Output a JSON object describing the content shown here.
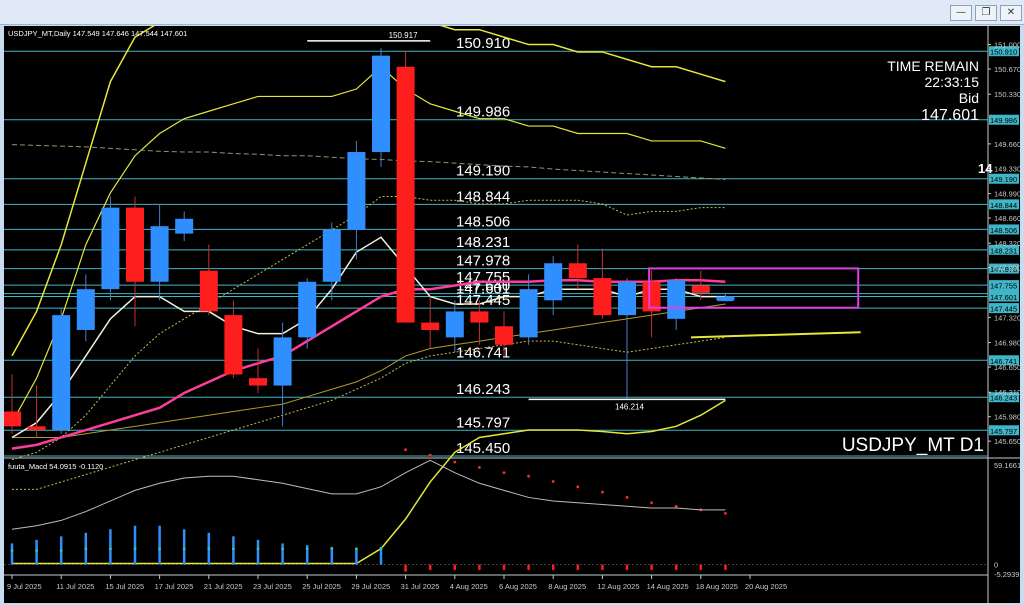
{
  "window": {
    "minimize_label": "—",
    "restore_label": "❐",
    "close_label": "✕"
  },
  "chart_data": {
    "type": "candlestick",
    "header": "USDJPY_MT,Daily  147.549 147.646 147.544 147.601",
    "symbol_watermark": "USDJPY_MT D1",
    "x_labels": [
      "9 Jul 2025",
      "11 Jul 2025",
      "15 Jul 2025",
      "17 Jul 2025",
      "21 Jul 2025",
      "23 Jul 2025",
      "25 Jul 2025",
      "29 Jul 2025",
      "31 Jul 2025",
      "4 Aug 2025",
      "6 Aug 2025",
      "8 Aug 2025",
      "12 Aug 2025",
      "14 Aug 2025",
      "18 Aug 2025",
      "20 Aug 2025"
    ],
    "y_ticks": [
      "151.000",
      "150.670",
      "150.330",
      "149.660",
      "149.330",
      "148.990",
      "148.660",
      "148.320",
      "147.990",
      "147.320",
      "146.980",
      "146.650",
      "146.310",
      "145.980",
      "145.650"
    ],
    "ylim": [
      145.45,
      151.25
    ],
    "candles": [
      {
        "o": 146.05,
        "h": 146.55,
        "l": 145.75,
        "c": 145.85
      },
      {
        "o": 145.85,
        "h": 146.4,
        "l": 145.7,
        "c": 145.8
      },
      {
        "o": 145.8,
        "h": 147.45,
        "l": 145.75,
        "c": 147.35
      },
      {
        "o": 147.15,
        "h": 147.9,
        "l": 147.0,
        "c": 147.7
      },
      {
        "o": 147.7,
        "h": 148.95,
        "l": 147.55,
        "c": 148.8
      },
      {
        "o": 148.8,
        "h": 148.95,
        "l": 147.2,
        "c": 147.8
      },
      {
        "o": 147.8,
        "h": 148.85,
        "l": 147.55,
        "c": 148.55
      },
      {
        "o": 148.45,
        "h": 148.75,
        "l": 148.35,
        "c": 148.65
      },
      {
        "o": 147.95,
        "h": 148.3,
        "l": 147.35,
        "c": 147.4
      },
      {
        "o": 147.35,
        "h": 147.55,
        "l": 146.5,
        "c": 146.55
      },
      {
        "o": 146.5,
        "h": 146.9,
        "l": 146.3,
        "c": 146.4
      },
      {
        "o": 146.4,
        "h": 147.25,
        "l": 145.85,
        "c": 147.05
      },
      {
        "o": 147.05,
        "h": 147.85,
        "l": 146.9,
        "c": 147.8
      },
      {
        "o": 147.8,
        "h": 148.6,
        "l": 147.55,
        "c": 148.5
      },
      {
        "o": 148.5,
        "h": 149.7,
        "l": 148.1,
        "c": 149.55
      },
      {
        "o": 149.55,
        "h": 150.95,
        "l": 149.35,
        "c": 150.85
      },
      {
        "o": 150.7,
        "h": 150.92,
        "l": 147.25,
        "c": 147.25
      },
      {
        "o": 147.25,
        "h": 147.6,
        "l": 146.9,
        "c": 147.15
      },
      {
        "o": 147.05,
        "h": 147.55,
        "l": 146.85,
        "c": 147.4
      },
      {
        "o": 147.4,
        "h": 147.55,
        "l": 146.95,
        "c": 147.25
      },
      {
        "o": 147.2,
        "h": 147.4,
        "l": 146.8,
        "c": 146.95
      },
      {
        "o": 147.05,
        "h": 147.9,
        "l": 146.95,
        "c": 147.7
      },
      {
        "o": 147.55,
        "h": 148.15,
        "l": 147.35,
        "c": 148.05
      },
      {
        "o": 148.05,
        "h": 148.3,
        "l": 147.7,
        "c": 147.85
      },
      {
        "o": 147.85,
        "h": 148.25,
        "l": 147.3,
        "c": 147.35
      },
      {
        "o": 147.35,
        "h": 147.85,
        "l": 146.21,
        "c": 147.8
      },
      {
        "o": 147.8,
        "h": 147.95,
        "l": 147.05,
        "c": 147.4
      },
      {
        "o": 147.3,
        "h": 147.85,
        "l": 147.15,
        "c": 147.82
      },
      {
        "o": 147.75,
        "h": 147.95,
        "l": 147.55,
        "c": 147.65
      },
      {
        "o": 147.55,
        "h": 147.65,
        "l": 147.54,
        "c": 147.6
      }
    ],
    "horizontal_levels": [
      {
        "label": "150.910",
        "value": 150.91,
        "right_tag": "150.910"
      },
      {
        "label": "149.986",
        "value": 149.986,
        "right_tag": "149.986"
      },
      {
        "label": "149.190",
        "value": 149.19,
        "right_tag": "149.190"
      },
      {
        "label": "148.844",
        "value": 148.844,
        "right_tag": "148.844"
      },
      {
        "label": "148.506",
        "value": 148.506,
        "right_tag": "148.506"
      },
      {
        "label": "148.231",
        "value": 148.231,
        "right_tag": "148.231"
      },
      {
        "label": "147.978",
        "value": 147.978,
        "right_tag": "147.978"
      },
      {
        "label": "147.755",
        "value": 147.755,
        "right_tag": "147.755"
      },
      {
        "label": "147.640",
        "value": 147.64,
        "right_tag": "147.640"
      },
      {
        "label": "147.601",
        "value": 147.601,
        "right_tag": "147.601"
      },
      {
        "label": "147.445",
        "value": 147.445,
        "right_tag": "147.445"
      },
      {
        "label": "146.741",
        "value": 146.741,
        "right_tag": "146.741"
      },
      {
        "label": "146.243",
        "value": 146.243,
        "right_tag": "146.243"
      },
      {
        "label": "145.797",
        "value": 145.797,
        "right_tag": "145.797"
      },
      {
        "label": "145.450",
        "value": 145.45,
        "right_tag": ""
      }
    ],
    "high_label": "150.917",
    "low_label": "146.214",
    "overlays": {
      "bb_upper": [
        146.8,
        147.4,
        148.3,
        149.4,
        150.5,
        151.1,
        151.3,
        151.4,
        151.4,
        151.3,
        151.4,
        151.5,
        151.6,
        151.7,
        151.6,
        151.6,
        151.4,
        151.3,
        151.2,
        151.2,
        151.1,
        151.0,
        151.0,
        150.9,
        150.9,
        150.8,
        150.7,
        150.7,
        150.6,
        150.5
      ],
      "bb_inner_upper": [
        145.9,
        146.5,
        147.3,
        148.3,
        149.0,
        149.5,
        149.8,
        150.0,
        150.1,
        150.2,
        150.3,
        150.3,
        150.3,
        150.3,
        150.4,
        150.7,
        150.4,
        150.2,
        150.1,
        150.0,
        150.0,
        149.9,
        149.9,
        149.8,
        149.8,
        149.8,
        149.7,
        149.7,
        149.7,
        149.6
      ],
      "sma_white": [
        145.7,
        145.9,
        146.3,
        146.8,
        147.3,
        147.6,
        147.6,
        147.4,
        147.4,
        147.2,
        147.1,
        147.1,
        147.3,
        147.7,
        148.2,
        148.4,
        148.0,
        147.6,
        147.5,
        147.5,
        147.6,
        147.6,
        147.7,
        147.7,
        147.7,
        147.6,
        147.7,
        147.7,
        147.6,
        147.6
      ],
      "ema_pink": [
        145.55,
        145.6,
        145.7,
        145.8,
        145.9,
        146.0,
        146.1,
        146.3,
        146.45,
        146.6,
        146.7,
        146.8,
        147.0,
        147.2,
        147.4,
        147.6,
        147.7,
        147.7,
        147.75,
        147.8,
        147.8,
        147.8,
        147.82,
        147.82,
        147.8,
        147.8,
        147.8,
        147.82,
        147.82,
        147.8
      ],
      "ma_olive": [
        145.7,
        145.7,
        145.7,
        145.75,
        145.8,
        145.85,
        145.9,
        145.95,
        146.0,
        146.05,
        146.1,
        146.15,
        146.25,
        146.35,
        146.45,
        146.6,
        146.8,
        146.9,
        146.95,
        147.0,
        147.05,
        147.1,
        147.15,
        147.2,
        147.25,
        147.3,
        147.35,
        147.4,
        147.45,
        147.5
      ],
      "ma_dashed_green": [
        149.65,
        149.64,
        149.63,
        149.62,
        149.6,
        149.58,
        149.56,
        149.55,
        149.55,
        149.53,
        149.52,
        149.5,
        149.5,
        149.48,
        149.46,
        149.45,
        149.43,
        149.42,
        149.4,
        149.38,
        149.36,
        149.35,
        149.32,
        149.3,
        149.28,
        149.26,
        149.24,
        149.22,
        149.2,
        149.18
      ],
      "bb_dotted_upper": [
        145.4,
        145.5,
        145.7,
        146.0,
        146.4,
        146.8,
        147.1,
        147.3,
        147.5,
        147.7,
        147.9,
        148.1,
        148.3,
        148.5,
        148.7,
        148.95,
        148.95,
        148.9,
        148.9,
        148.85,
        148.85,
        148.9,
        148.9,
        148.9,
        148.85,
        148.7,
        148.75,
        148.75,
        148.8,
        148.8
      ],
      "bb_dotted_lower": [
        145.0,
        145.0,
        145.1,
        145.2,
        145.3,
        145.4,
        145.5,
        145.6,
        145.7,
        145.8,
        145.9,
        146.0,
        146.1,
        146.2,
        146.35,
        146.5,
        146.7,
        146.8,
        146.85,
        146.9,
        146.95,
        147.0,
        147.0,
        146.95,
        146.9,
        146.85,
        146.9,
        146.95,
        147.0,
        147.05
      ],
      "bb_lower": [
        144.0,
        144.0,
        144.0,
        144.0,
        144.0,
        144.0,
        144.0,
        144.0,
        144.0,
        144.0,
        144.0,
        144.0,
        144.0,
        144.0,
        144.0,
        144.2,
        144.6,
        145.1,
        145.5,
        145.7,
        145.75,
        145.8,
        145.8,
        145.8,
        145.78,
        145.75,
        145.78,
        145.85,
        146.0,
        146.2
      ]
    },
    "trendline_yellow": {
      "from": [
        27.6,
        147.05
      ],
      "to": [
        34.5,
        147.12
      ]
    },
    "box_magenta": {
      "x0": 25.9,
      "x1": 34.4,
      "y0": 147.98,
      "y1": 147.45
    },
    "panel_text": {
      "time_remain_label": "TIME REMAIN",
      "time_remain": "22:33:15",
      "bid_label": "Bid",
      "bid": "147.601"
    },
    "macd": {
      "header": "fuuta_Macd 54.0915  -0.1120",
      "top_tick": "59.1661",
      "zero_tick": "0",
      "bottom_tick": "-5.2939",
      "line": [
        20,
        22,
        25,
        30,
        36,
        42,
        46,
        49,
        50,
        50,
        48,
        46,
        43,
        40,
        40,
        44,
        52,
        59,
        52,
        46,
        42,
        38,
        36,
        35,
        34,
        33,
        32,
        32,
        31,
        31
      ],
      "hist": [
        12,
        14,
        16,
        18,
        20,
        22,
        22,
        20,
        18,
        16,
        14,
        12,
        11,
        10,
        9,
        10,
        -4,
        -3,
        -3,
        -3,
        -3,
        -3,
        -3,
        -3,
        -3,
        -3,
        -3,
        -3,
        -3,
        -3
      ],
      "signal_dots": [
        8,
        8,
        8,
        9,
        9,
        9,
        9,
        9,
        9,
        9,
        9,
        9,
        9,
        9,
        9,
        9,
        65,
        62,
        58,
        55,
        52,
        50,
        47,
        44,
        41,
        38,
        35,
        33,
        31,
        29
      ]
    },
    "right_partial_label": "14"
  }
}
